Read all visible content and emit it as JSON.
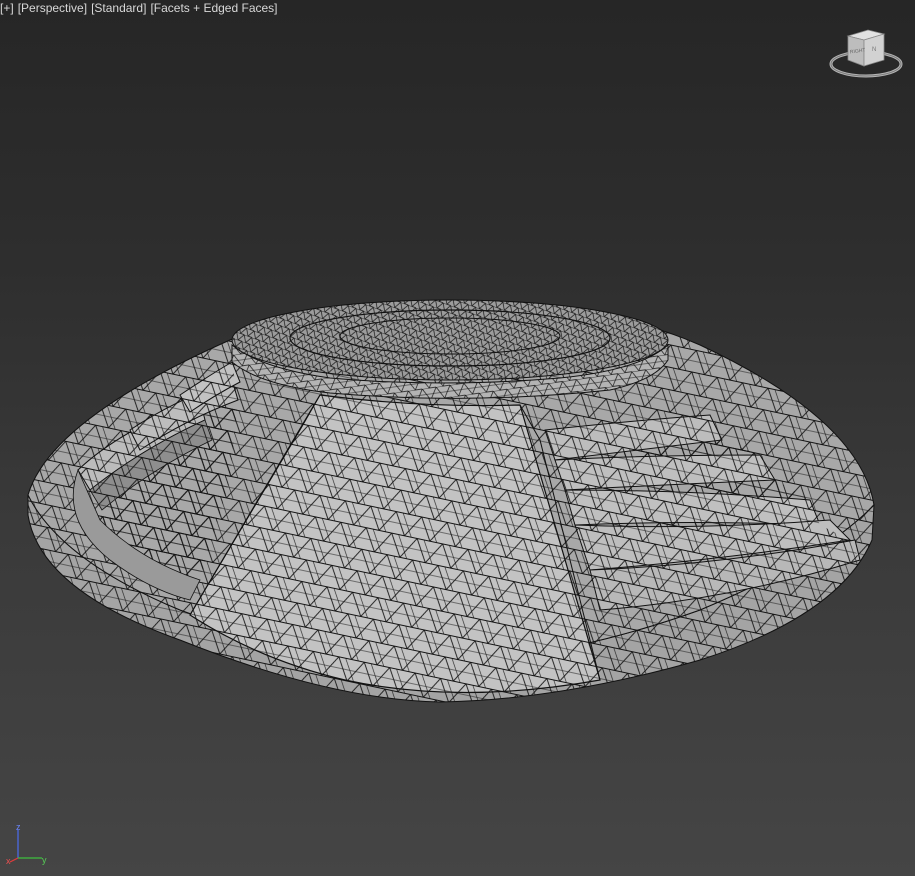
{
  "viewport": {
    "label": {
      "plus": "[+]",
      "view": "[Perspective]",
      "shading": "[Standard]",
      "display": "[Facets + Edged Faces]"
    },
    "viewcube": {
      "face_label": "RIGHT"
    },
    "axes": {
      "x": "x",
      "y": "y",
      "z": "z"
    }
  },
  "colors": {
    "background_top": "#262626",
    "background_bottom": "#454545",
    "mesh_face": "#a9a9a9",
    "mesh_edge": "#111111"
  }
}
